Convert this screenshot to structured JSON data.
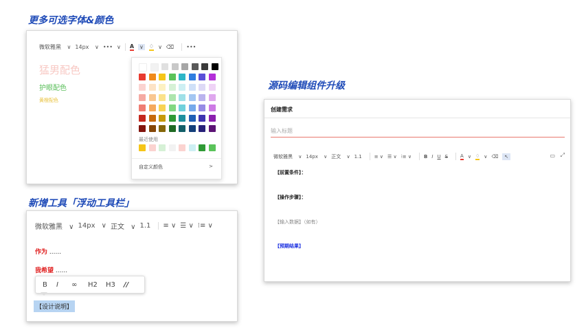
{
  "sections": {
    "fonts_colors": "更多可选字体&颜色",
    "source_editor": "源码编辑组件升级",
    "floating_toolbar": "新增工具「浮动工具栏」"
  },
  "panel1": {
    "toolbar": {
      "font": "微软雅黑",
      "size": "14px",
      "more": "•••",
      "text_color": "A",
      "bg_color": "♢",
      "clear": "⌫",
      "more2": "•••"
    },
    "samples": [
      {
        "text": "猛男配色",
        "color": "#f8c9c4"
      },
      {
        "text": "护眼配色",
        "color": "#5cbf5c"
      },
      {
        "text": "黄橙配色",
        "color": "#e8c13a"
      }
    ],
    "palette": {
      "rows": [
        [
          "#ffffff",
          "#f2f2f2",
          "#e0e0e0",
          "#c8c8c8",
          "#a6a6a6",
          "#595959",
          "#3a3a3a",
          "#000000"
        ],
        [
          "#e83a2f",
          "#f08a1a",
          "#f5c518",
          "#5ac35a",
          "#2db6c8",
          "#2f7de0",
          "#5a4fd8",
          "#b32fd8"
        ],
        [
          "#fbd3d0",
          "#fde3c6",
          "#fdf1c2",
          "#d6f1d6",
          "#cdeff3",
          "#cfe0f8",
          "#ddd9f6",
          "#efd3f6"
        ],
        [
          "#f5aaa3",
          "#f9c791",
          "#fbe28a",
          "#ade5ad",
          "#9fe0e8",
          "#a3c6f2",
          "#bab3ee",
          "#dfa7ee"
        ],
        [
          "#ef7d73",
          "#f5a95c",
          "#f8d353",
          "#82d882",
          "#6fd0dc",
          "#75a9eb",
          "#968be5",
          "#cd7ae5"
        ],
        [
          "#c4281e",
          "#c66a0d",
          "#c69a0a",
          "#2f9a35",
          "#1d8f9e",
          "#1f5eb5",
          "#3e33b0",
          "#8b1fae"
        ],
        [
          "#82150e",
          "#844607",
          "#85670a",
          "#1f6a24",
          "#135f69",
          "#143f7a",
          "#282179",
          "#5c1475"
        ]
      ],
      "recent_label": "最近使用",
      "recent": [
        "#f5c518",
        "#fbd3d0",
        "#d6f1d6",
        "#f2f2f2",
        "#fbd3d0",
        "#cdeff3",
        "#2f9a35",
        "#5ac35a"
      ],
      "custom_label": "自定义颜色",
      "custom_arrow": ">"
    }
  },
  "panel2": {
    "title": "创建需求",
    "title_placeholder": "输入标题",
    "toolbar": {
      "font": "微软雅黑",
      "size": "14px",
      "style": "正文",
      "lh": "1.1",
      "b": "B",
      "i": "I",
      "u": "U",
      "s": "S",
      "a": "A",
      "bg": "♢",
      "clear": "⌫"
    },
    "lines": [
      {
        "text": "【前置条件】：",
        "color": "#222",
        "bold": true
      },
      {
        "text": "【操作步骤】：",
        "color": "#222",
        "bold": true
      },
      {
        "text": "【输入数据】（如有）",
        "color": "#888",
        "bold": false
      },
      {
        "text": "【预期结果】",
        "color": "#1a2fe0",
        "bold": true
      }
    ]
  },
  "panel3": {
    "toolbar": {
      "font": "微软雅黑",
      "size": "14px",
      "style": "正文",
      "lh": "1.1"
    },
    "line1_bold": "作为",
    "line1_rest": "......",
    "line2_bold": "我希望",
    "line2_rest": "......",
    "float": {
      "b": "B",
      "i": "I",
      "link": "∞",
      "h2": "H2",
      "h3": "H3",
      "quote": "//"
    },
    "selected": "【设计说明】"
  }
}
